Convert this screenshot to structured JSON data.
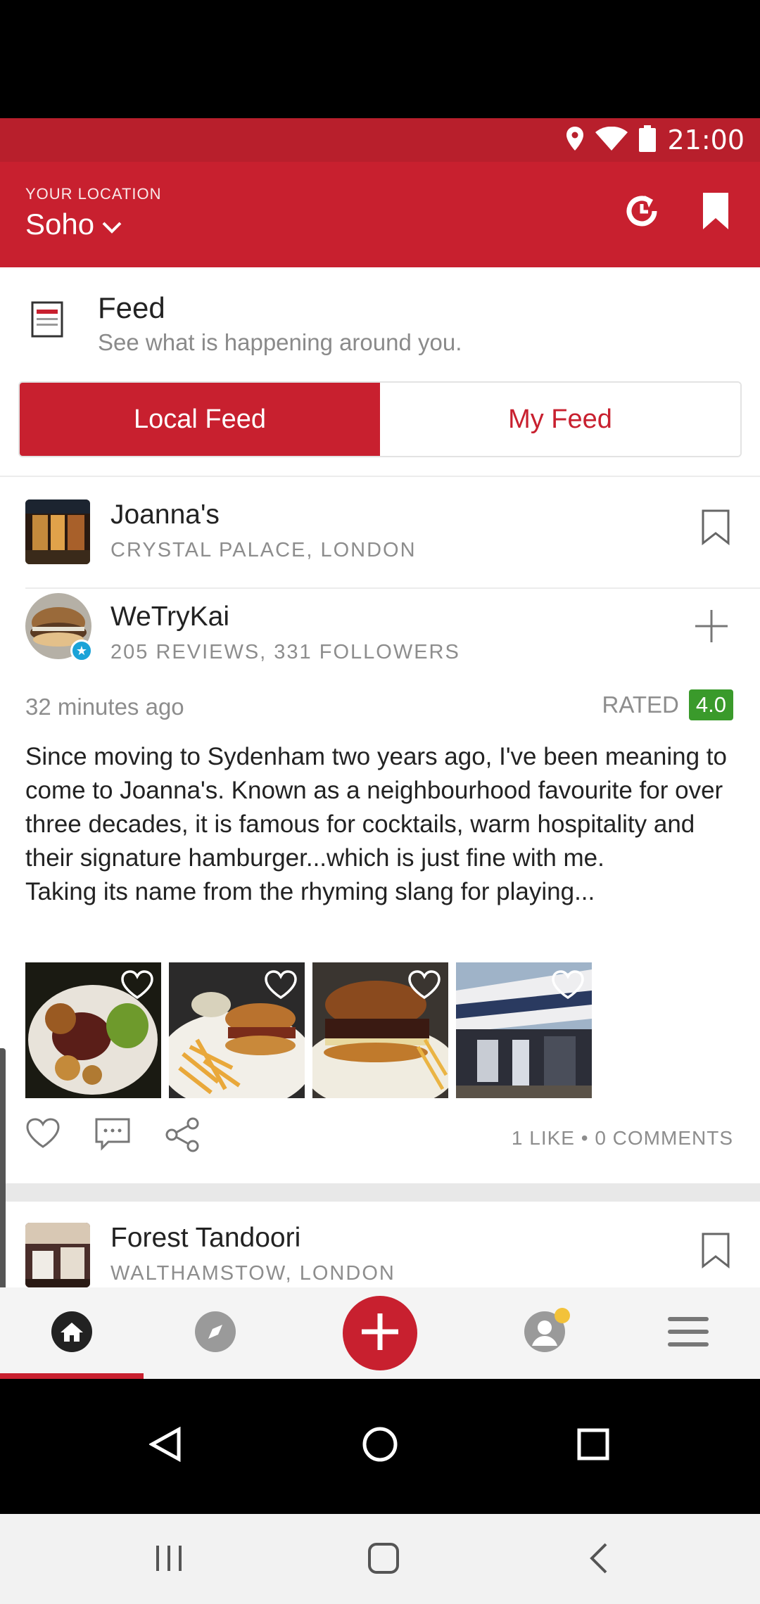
{
  "status": {
    "time": "21:00"
  },
  "header": {
    "location_caption": "YOUR LOCATION",
    "location_value": "Soho"
  },
  "feed": {
    "title": "Feed",
    "subtitle": "See what is happening around you.",
    "tabs": [
      {
        "label": "Local Feed",
        "active": true
      },
      {
        "label": "My Feed",
        "active": false
      }
    ]
  },
  "post": {
    "place": {
      "name": "Joanna's",
      "location": "CRYSTAL PALACE, LONDON"
    },
    "reviewer": {
      "name": "WeTryKai",
      "stats": "205 REVIEWS, 331 FOLLOWERS"
    },
    "time_ago": "32 minutes ago",
    "rated_label": "RATED",
    "rating": "4.0",
    "text": "Since moving to Sydenham two years ago, I've been meaning to come to Joanna's. Known as a neighbourhood favourite for over three decades, it is famous for cocktails, warm hospitality and their signature hamburger...which is just fine with me.\nTaking its name from the rhyming slang for playing...",
    "photo_count": 4,
    "counts": "1 LIKE • 0 COMMENTS"
  },
  "next_post": {
    "place": {
      "name": "Forest Tandoori",
      "location": "WALTHAMSTOW, LONDON"
    }
  },
  "colors": {
    "brand": "#c8202f",
    "status_bar": "#b81f2c",
    "rating_badge": "#3a9a2b",
    "verified": "#1aa3d8"
  },
  "bottom_nav": {
    "items": [
      "home-icon",
      "explore-icon",
      "add-icon",
      "profile-icon",
      "menu-icon"
    ],
    "active": "home-icon"
  }
}
